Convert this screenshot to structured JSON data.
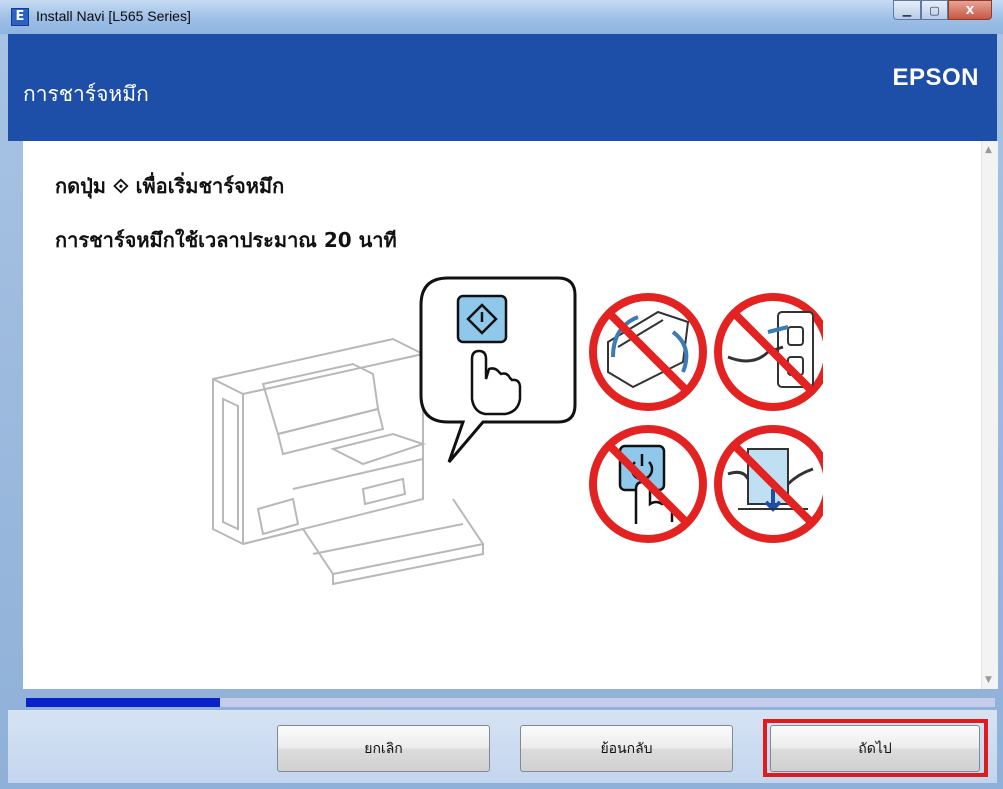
{
  "window": {
    "title": "Install Navi [L565 Series]",
    "app_icon_letter": "E",
    "controls": {
      "minimize": "▁",
      "maximize": "▢",
      "close": "X"
    }
  },
  "header": {
    "title": "การชาร์จหมึก",
    "brand": "EPSON"
  },
  "main": {
    "instruction": "กดปุ่ม ⟐ เพื่อเริ่มชาร์จหมึก",
    "duration_text": "การชาร์จหมึกใช้เวลาประมาณ 20 นาที",
    "illustration": {
      "printer": "printer-illustration",
      "start_button_icon": "start-diamond-icon",
      "warnings": [
        "do-not-open-scanner",
        "do-not-unplug",
        "do-not-press-power",
        "do-not-load-paper"
      ]
    }
  },
  "progress": {
    "value": 0.2
  },
  "footer": {
    "cancel_label": "ยกเลิก",
    "back_label": "ย้อนกลับ",
    "next_label": "ถัดไป"
  },
  "colors": {
    "header_bg": "#1d4fa8",
    "progress_fill": "#0a23c9",
    "progress_track": "#c6ccec",
    "highlight": "#e11b1b",
    "prohibition_red": "#e32222",
    "icon_blue": "#8fc8ea"
  }
}
